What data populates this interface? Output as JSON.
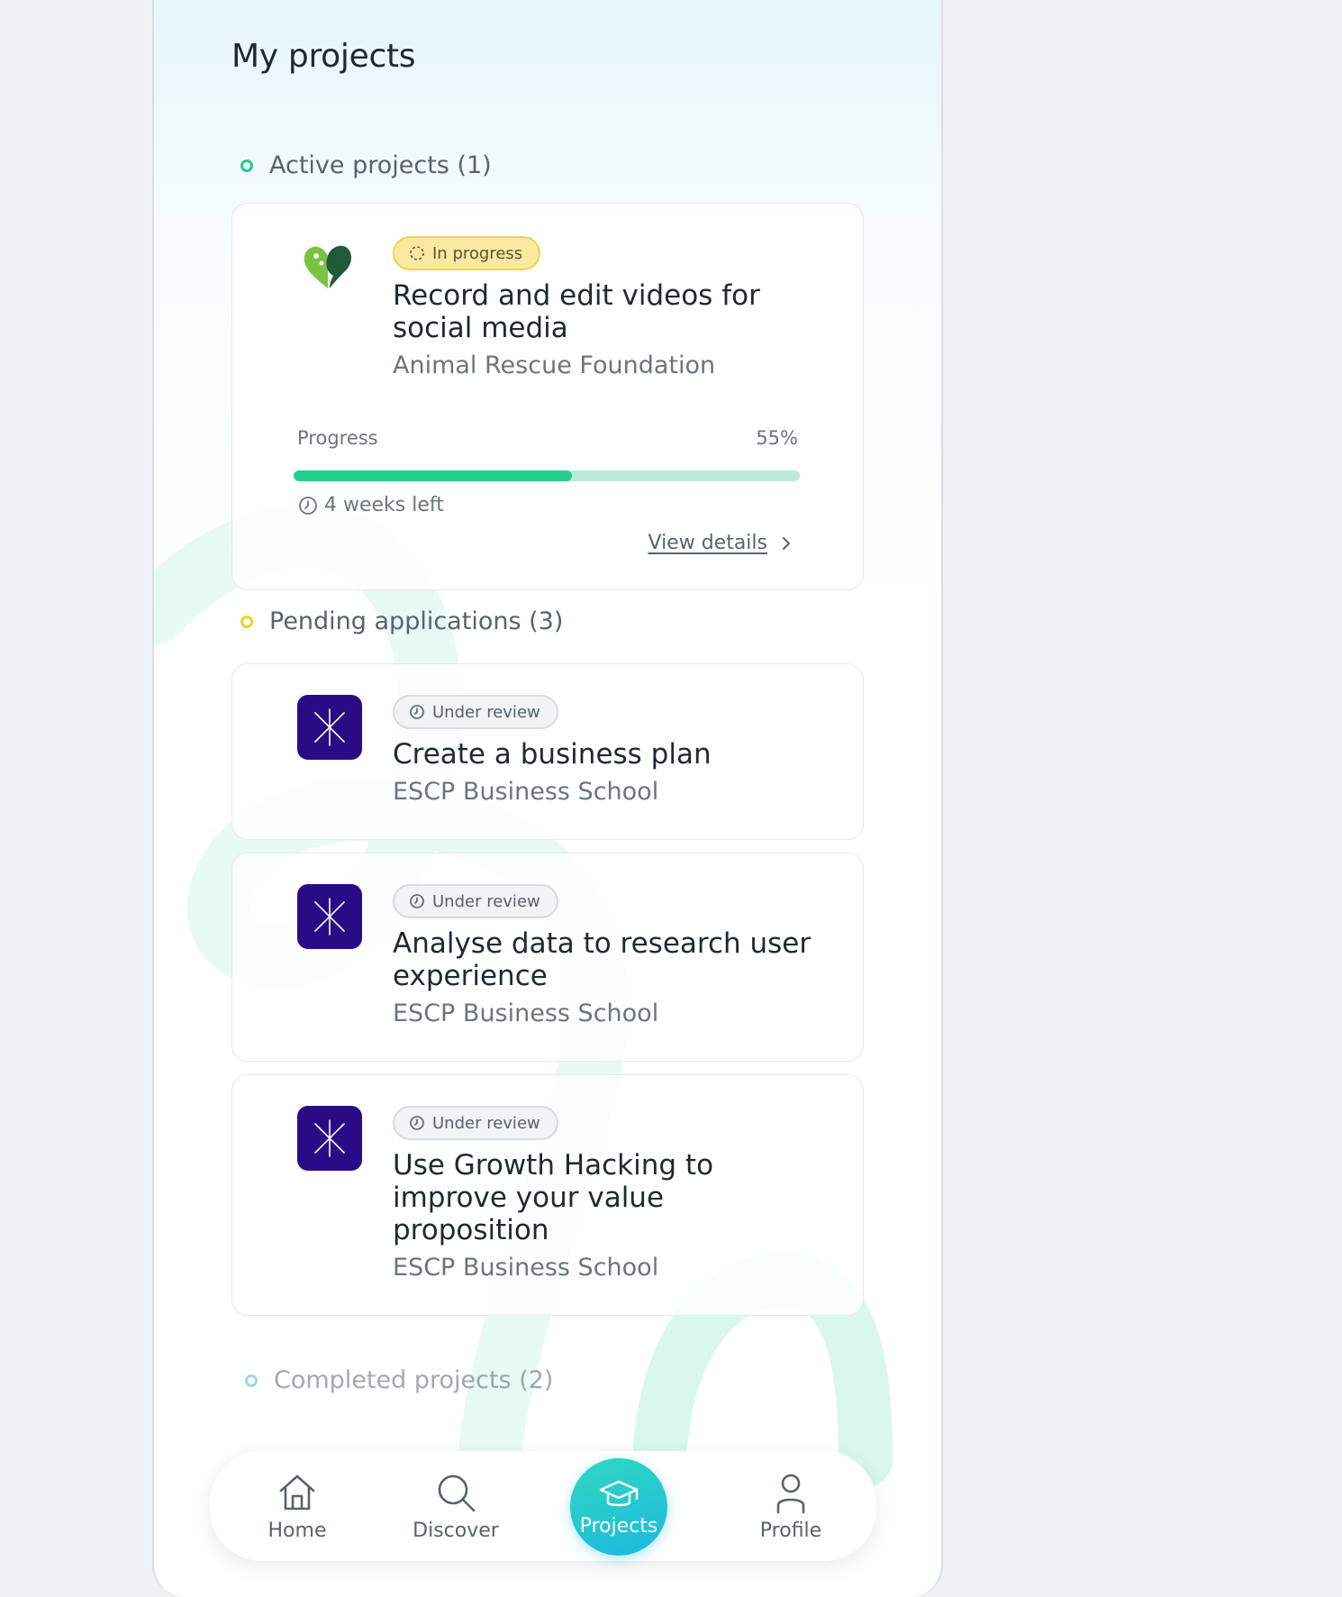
{
  "page": {
    "title": "My projects"
  },
  "sections": {
    "active": {
      "heading": "Active projects (1)"
    },
    "pending": {
      "heading": "Pending applications (3)"
    },
    "completed": {
      "heading": "Completed projects (2)"
    }
  },
  "active_project": {
    "status": "In progress",
    "title": "Record and edit videos for social media",
    "organization": "Animal Rescue Foundation",
    "progress_label": "Progress",
    "progress_text": "55%",
    "progress_fraction": 0.55,
    "time_left": "4 weeks left",
    "view_details": "View details"
  },
  "pending_applications": [
    {
      "status": "Under review",
      "title": "Create a business plan",
      "organization": "ESCP Business School"
    },
    {
      "status": "Under review",
      "title": "Analyse data to research user experience",
      "organization": "ESCP Business School"
    },
    {
      "status": "Under review",
      "title": "Use Growth Hacking to improve your value proposition",
      "organization": "ESCP Business School"
    }
  ],
  "tabbar": {
    "home": "Home",
    "discover": "Discover",
    "projects": "Projects",
    "profile": "Profile",
    "active_tab": "projects"
  },
  "icons": {
    "active_org_logo": "heart-paw-logo",
    "pending_org_logo": "escp-star-logo",
    "status_progress": "spinner-icon",
    "status_review": "clock-icon",
    "home": "home-icon",
    "discover": "search-icon",
    "projects": "graduation-cap-icon",
    "profile": "user-icon"
  },
  "colors": {
    "accent_green": "#23cf8c",
    "progress_track": "#b9ebd8",
    "badge_yellow": "#fbe9a2",
    "escp_purple": "#2a0b86",
    "tab_active": "#1db8e0"
  }
}
